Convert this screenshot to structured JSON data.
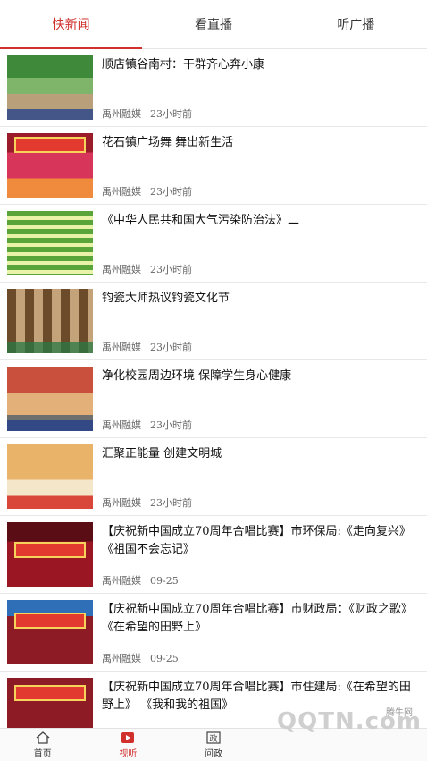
{
  "tabs": [
    "快新闻",
    "看直播",
    "听广播"
  ],
  "news": [
    {
      "title": "顺店镇谷南村：干群齐心奔小康",
      "source": "禹州融媒",
      "time": "23小时前"
    },
    {
      "title": "花石镇广场舞 舞出新生活",
      "source": "禹州融媒",
      "time": "23小时前"
    },
    {
      "title": "《中华人民共和国大气污染防治法》二",
      "source": "禹州融媒",
      "time": "23小时前"
    },
    {
      "title": "钧瓷大师热议钧瓷文化节",
      "source": "禹州融媒",
      "time": "23小时前"
    },
    {
      "title": "净化校园周边环境 保障学生身心健康",
      "source": "禹州融媒",
      "time": "23小时前"
    },
    {
      "title": "汇聚正能量 创建文明城",
      "source": "禹州融媒",
      "time": "23小时前"
    },
    {
      "title": "【庆祝新中国成立70周年合唱比赛】市环保局:《走向复兴》 《祖国不会忘记》",
      "source": "禹州融媒",
      "time": "09-25"
    },
    {
      "title": "【庆祝新中国成立70周年合唱比赛】市财政局：《财政之歌》 《在希望的田野上》",
      "source": "禹州融媒",
      "time": "09-25"
    },
    {
      "title": "【庆祝新中国成立70周年合唱比赛】市住建局:《在希望的田野上》 《我和我的祖国》",
      "source": "",
      "time": ""
    }
  ],
  "nav": [
    {
      "label": "首页",
      "icon": "home-icon"
    },
    {
      "label": "视听",
      "icon": "video-icon"
    },
    {
      "label": "问政",
      "icon": "politics-icon"
    },
    {
      "label": "",
      "icon": "hidden-icon"
    },
    {
      "label": "",
      "icon": "hidden-icon"
    }
  ],
  "watermark": {
    "brand": "QQTN.com",
    "small": "腾牛网"
  },
  "colors": {
    "accent": "#d0312d"
  }
}
